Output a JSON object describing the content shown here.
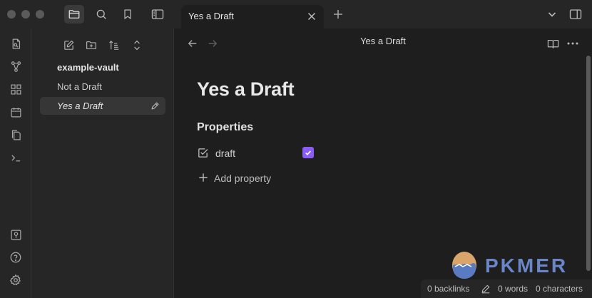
{
  "window": {
    "tab_title": "Yes a Draft"
  },
  "sidebar": {
    "vault_name": "example-vault",
    "files": [
      {
        "label": "Not a Draft",
        "active": false
      },
      {
        "label": "Yes a Draft",
        "active": true
      }
    ]
  },
  "view": {
    "header_title": "Yes a Draft",
    "doc_title": "Yes a Draft",
    "properties_heading": "Properties",
    "property": {
      "name": "draft",
      "checked": true
    },
    "add_property_label": "Add property"
  },
  "watermark": {
    "text": "PKMER"
  },
  "status_bar": {
    "backlinks": "0 backlinks",
    "words": "0 words",
    "characters": "0 characters"
  },
  "colors": {
    "accent": "#8b5cf6",
    "watermark": "#6a86c9"
  },
  "icons": [
    "files-icon",
    "search-icon",
    "bookmark-icon",
    "sidebar-left-icon",
    "plus-icon",
    "chevron-down-icon",
    "sidebar-right-icon",
    "back-arrow-icon",
    "forward-arrow-icon",
    "reading-view-icon",
    "more-options-icon",
    "new-note-icon",
    "new-folder-icon",
    "sort-icon",
    "collapse-icon",
    "switcher-icon",
    "graph-icon",
    "canvas-icon",
    "calendar-icon",
    "templates-icon",
    "terminal-icon",
    "vault-icon",
    "help-icon",
    "settings-icon",
    "checkbox-property-icon",
    "pencil-icon"
  ]
}
